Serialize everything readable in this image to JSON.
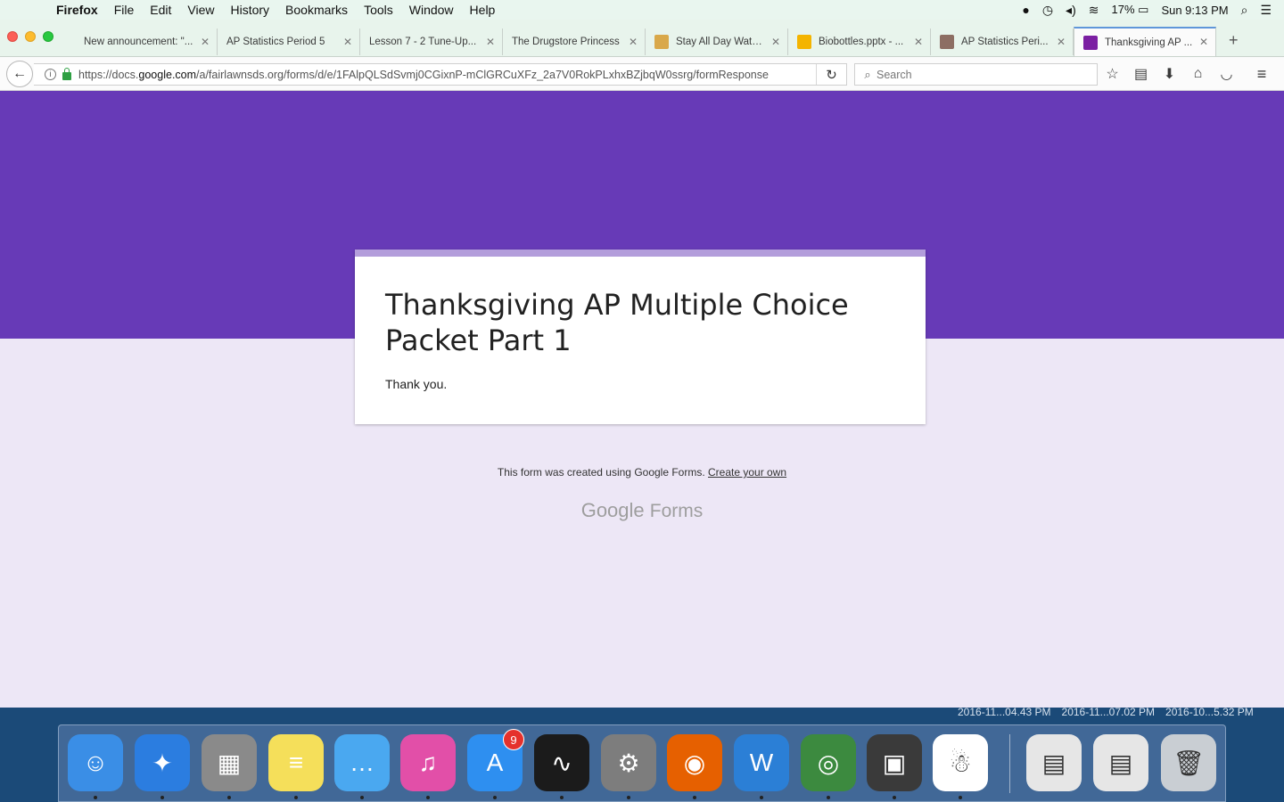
{
  "menubar": {
    "app_name": "Firefox",
    "items": [
      "File",
      "Edit",
      "View",
      "History",
      "Bookmarks",
      "Tools",
      "Window",
      "Help"
    ],
    "battery": "17%",
    "clock": "Sun 9:13 PM"
  },
  "tabs": [
    {
      "title": "New announcement: \"...",
      "favicon_color": ""
    },
    {
      "title": "AP Statistics Period 5",
      "favicon_color": ""
    },
    {
      "title": "Lesson 7 - 2 Tune-Up...",
      "favicon_color": ""
    },
    {
      "title": "The Drugstore Princess",
      "favicon_color": ""
    },
    {
      "title": "Stay All Day Wate...",
      "favicon_color": "#d9a84a"
    },
    {
      "title": "Biobottles.pptx - ...",
      "favicon_color": "#f4b400"
    },
    {
      "title": "AP Statistics Peri...",
      "favicon_color": "#8d6e63"
    },
    {
      "title": "Thanksgiving AP ...",
      "favicon_color": "#7b1fa2"
    }
  ],
  "navbar": {
    "url_prefix": "https://docs.",
    "url_host": "google.com",
    "url_path": "/a/fairlawnsds.org/forms/d/e/1FAlpQLSdSvmj0CGixnP-mClGRCuXFz_2a7V0RokPLxhxBZjbqW0ssrg/formResponse",
    "search_placeholder": "Search"
  },
  "form": {
    "title": "Thanksgiving AP Multiple Choice Packet Part 1",
    "message": "Thank you.",
    "footer_text": "This form was created using Google Forms. ",
    "footer_link": "Create your own",
    "logo_google": "Google",
    "logo_forms": "Forms",
    "header_color": "#673ab7",
    "background_color": "#ede7f6",
    "accent_color": "#b39ddb"
  },
  "desktop": {
    "labels": [
      "2016-11...04.43 PM",
      "2016-11...07.02 PM",
      "2016-10...5.32 PM"
    ]
  },
  "dock": {
    "items": [
      {
        "name": "finder-icon",
        "color": "#3a8ee6",
        "glyph": "☺"
      },
      {
        "name": "safari-icon",
        "color": "#2b7de0",
        "glyph": "✦"
      },
      {
        "name": "calculator-icon",
        "color": "#8a8a8a",
        "glyph": "▦"
      },
      {
        "name": "notes-icon",
        "color": "#f5df5a",
        "glyph": "≡"
      },
      {
        "name": "messages-icon",
        "color": "#4aa8f0",
        "glyph": "…"
      },
      {
        "name": "itunes-icon",
        "color": "#e24fa8",
        "glyph": "♫"
      },
      {
        "name": "app-store-icon",
        "color": "#2e8ff0",
        "glyph": "A"
      },
      {
        "name": "activity-monitor-icon",
        "color": "#1b1b1b",
        "glyph": "∿"
      },
      {
        "name": "system-preferences-icon",
        "color": "#7d7d7d",
        "glyph": "⚙"
      },
      {
        "name": "firefox-icon",
        "color": "#e66000",
        "glyph": "◉"
      },
      {
        "name": "word-icon",
        "color": "#2b7fd6",
        "glyph": "W"
      },
      {
        "name": "chrome-icon",
        "color": "#3c8a3f",
        "glyph": "◎"
      },
      {
        "name": "printer-icon",
        "color": "#3a3a3a",
        "glyph": "▣"
      },
      {
        "name": "podcast-capture-icon",
        "color": "#ffffff",
        "glyph": "☃"
      },
      {
        "name": "document-thumbnail-icon",
        "color": "#e6e6e6",
        "glyph": "▤"
      },
      {
        "name": "document-thumbnail-icon",
        "color": "#e6e6e6",
        "glyph": "▤"
      },
      {
        "name": "trash-icon",
        "color": "#c9ced3",
        "glyph": "🗑"
      }
    ],
    "app_store_badge": "9"
  }
}
